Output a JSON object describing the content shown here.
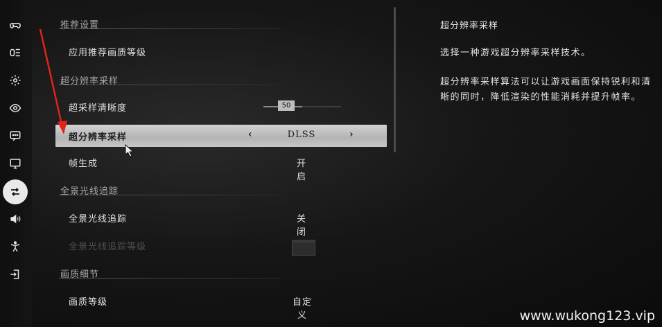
{
  "sections": {
    "recommended": {
      "title": "推荐设置",
      "apply_label": "应用推荐画质等级"
    },
    "super_resolution": {
      "title": "超分辨率采样",
      "sharpness_label": "超采样清晰度",
      "sharpness_value": "50",
      "sharpness_fraction": 0.5,
      "sampling_label": "超分辨率采样",
      "sampling_value": "DLSS",
      "prev_arrow": "‹",
      "next_arrow": "›",
      "frame_gen_label": "帧生成",
      "frame_gen_value": "开启"
    },
    "ray_tracing": {
      "title": "全景光线追踪",
      "rt_label": "全景光线追踪",
      "rt_value": "关闭",
      "rt_level_label": "全景光线追踪等级"
    },
    "quality": {
      "title": "画质细节",
      "quality_label": "画质等级",
      "quality_value": "自定义"
    }
  },
  "detail": {
    "title": "超分辨率采样",
    "paragraph1": "选择一种游戏超分辨率采样技术。",
    "paragraph2": "超分辨率采样算法可以让游戏画面保持锐利和清晰的同时，降低渲染的性能消耗并提升帧率。"
  },
  "rail_icons": [
    "gamepad-icon",
    "controller-layout-icon",
    "gear-icon",
    "eye-icon",
    "chat-icon",
    "monitor-icon",
    "sliders-icon",
    "audio-icon",
    "accessibility-icon",
    "exit-icon"
  ],
  "watermark": "www.wukong123.vip",
  "colors": {
    "selected_row": "#c4c4c4",
    "annotation_arrow": "#e2231a"
  }
}
